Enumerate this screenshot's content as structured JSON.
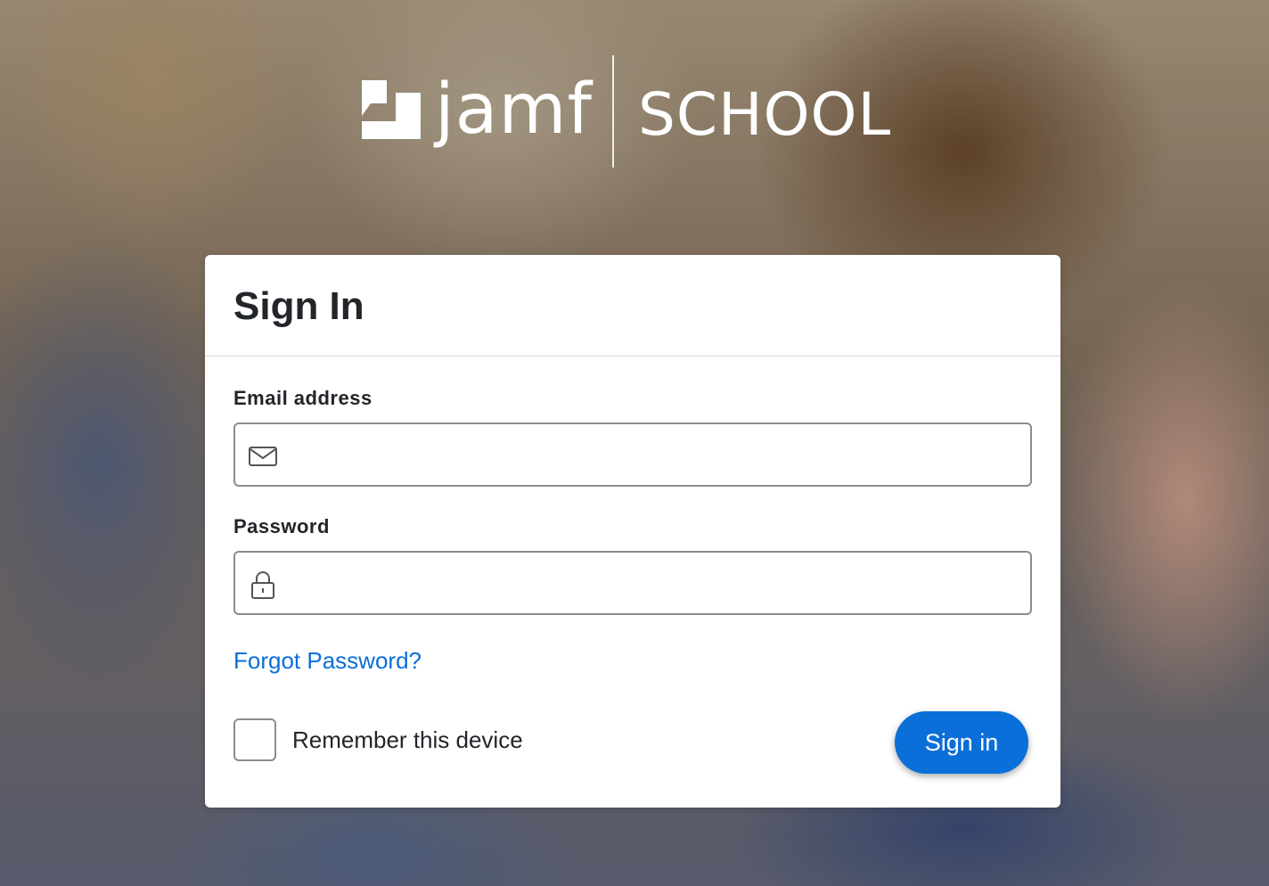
{
  "brand": {
    "logo_text": "jamf",
    "product": "SCHOOL"
  },
  "signin": {
    "title": "Sign In",
    "email_label": "Email address",
    "email_value": "",
    "email_icon": "mail-icon",
    "password_label": "Password",
    "password_value": "",
    "password_icon": "lock-icon",
    "forgot_label": "Forgot Password?",
    "remember_label": "Remember this device",
    "remember_checked": false,
    "submit_label": "Sign in"
  },
  "colors": {
    "accent": "#0a6fd8",
    "text": "#222529",
    "border": "#8c8c8c"
  }
}
